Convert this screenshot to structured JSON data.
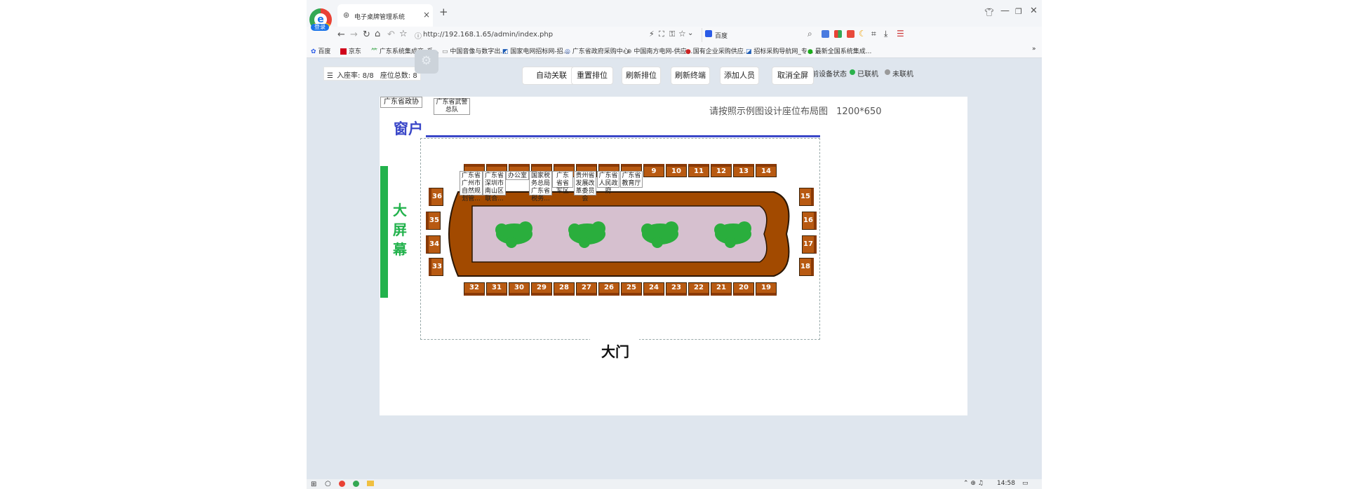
{
  "browser": {
    "login_badge": "登录",
    "tab_title": "电子桌牌管理系统",
    "url": "http://192.168.1.65/admin/index.php",
    "search_engine": "百度",
    "bookmarks": [
      "百度",
      "京东",
      "广东系统集成商_系...",
      "中国音像与数字出...",
      "国家电网招标网-招...",
      "广东省政府采购中心",
      "中国南方电网-供应...",
      "国有企业采购供应...",
      "招标采购导航网_专...",
      "最新全国系统集成..."
    ],
    "more_symbol": "»"
  },
  "toolbar": {
    "attendance_label": "入座率: 8/8",
    "total_seats_label": "座位总数: 8",
    "buttons": [
      "自动关联",
      "重置排位",
      "刷新排位",
      "刷新终端",
      "添加人员",
      "取消全屏"
    ],
    "device_status_label": "当前设备状态",
    "online_label": "已联机",
    "offline_label": "未联机",
    "online_color": "#2bb24c",
    "offline_color": "#9a9a9a"
  },
  "canvas": {
    "top_tags": [
      "广东省政协",
      "广东省武警总队"
    ],
    "hint": "请按照示例图设计座位布局图",
    "size": "1200*650",
    "window_label": "窗户",
    "screen_label": [
      "大",
      "屏",
      "幕"
    ],
    "door_label": "大门",
    "screen_color": "#22b24c",
    "window_color": "#3a47c8",
    "table_color": "#a24a00",
    "inner_color": "#d6c0cf",
    "plant_color": "#2aae3d"
  },
  "seats": {
    "top_numbers": [
      "",
      "",
      "",
      "",
      "",
      "",
      "",
      "",
      "9",
      "10",
      "11",
      "12",
      "13",
      "14"
    ],
    "bottom_numbers": [
      "32",
      "31",
      "30",
      "29",
      "28",
      "27",
      "26",
      "25",
      "24",
      "23",
      "22",
      "21",
      "20",
      "19"
    ],
    "left_numbers": [
      "36",
      "35",
      "34",
      "33"
    ],
    "right_numbers": [
      "15",
      "16",
      "17",
      "18"
    ]
  },
  "people": [
    {
      "name": "广东省广州市自然规划管..."
    },
    {
      "name": "广东省深圳市南山区联合..."
    },
    {
      "name": "办公室"
    },
    {
      "name": "国家税务总局广东省税务..."
    },
    {
      "name": "广东省省军区"
    },
    {
      "name": "贵州省发展改革委员会"
    },
    {
      "name": "广东省人民政府"
    },
    {
      "name": "广东省教育厅"
    }
  ],
  "taskbar": {
    "clock": "14:58"
  }
}
